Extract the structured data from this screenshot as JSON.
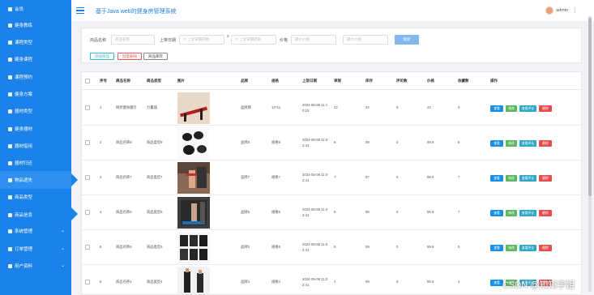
{
  "app": {
    "title": "基于Java web的健身房管理系统",
    "user": "admin",
    "watermark": "CSDN @知知学姐"
  },
  "sidebar": {
    "items": [
      {
        "label": "会员"
      },
      {
        "label": "健身教练"
      },
      {
        "label": "课程类型"
      },
      {
        "label": "健身课程"
      },
      {
        "label": "课程预约"
      },
      {
        "label": "健身方案"
      },
      {
        "label": "器材类型"
      },
      {
        "label": "健身器材"
      },
      {
        "label": "器材借用"
      },
      {
        "label": "器材归还"
      },
      {
        "label": "物品遗失"
      },
      {
        "label": "商品类型"
      },
      {
        "label": "商品信息"
      },
      {
        "label": "系统管理"
      },
      {
        "label": "订单管理"
      },
      {
        "label": "用户资料"
      }
    ]
  },
  "search": {
    "name_label": "商品名称",
    "name_placeholder": "商品名称",
    "date_label": "上架日期",
    "date_start_placeholder": "上架日期开始",
    "date_end_placeholder": "上架日期结束",
    "price_label": "价格",
    "price_min_placeholder": "最小价格",
    "price_max_placeholder": "最大价格",
    "search_button": "搜索",
    "add_button": "添加商品",
    "batch_delete_button": "批量删除",
    "stock_button": "商品库存"
  },
  "table": {
    "headers": [
      "序号",
      "商品名称",
      "商品类型",
      "图片",
      "品牌",
      "规格",
      "上架日期",
      "单限",
      "库存",
      "评论数",
      "价格",
      "收藏数",
      "操作"
    ],
    "rows": [
      {
        "no": "1",
        "name": "网状健身腿针",
        "type": "力量器",
        "brand": "品牌牌",
        "spec": "12*12",
        "date_a": "2024-05-08 11:1",
        "date_b": "0:15",
        "limit": "22",
        "stock": "22",
        "comments": "0",
        "price": "22",
        "fav": "0"
      },
      {
        "no": "2",
        "name": "商品名称8",
        "type": "商品类型8",
        "brand": "品牌8",
        "spec": "规格8",
        "date_a": "2024-05-08 11:0",
        "date_b": "2:41",
        "limit": "8",
        "stock": "99",
        "comments": "0",
        "price": "99.9",
        "fav": "8"
      },
      {
        "no": "3",
        "name": "商品名称7",
        "type": "商品类型7",
        "brand": "品牌7",
        "spec": "规格7",
        "date_a": "2024-05-08 11:0",
        "date_b": "2:41",
        "limit": "7",
        "stock": "97",
        "comments": "0",
        "price": "99.9",
        "fav": "7"
      },
      {
        "no": "4",
        "name": "商品名称6",
        "type": "商品类型6",
        "brand": "品牌6",
        "spec": "规格6",
        "date_a": "2024-05-08 11:0",
        "date_b": "2:41",
        "limit": "6",
        "stock": "98",
        "comments": "0",
        "price": "99.9",
        "fav": "7"
      },
      {
        "no": "5",
        "name": "商品名称5",
        "type": "商品类型5",
        "brand": "品牌5",
        "spec": "规格5",
        "date_a": "2024-05-08 11:0",
        "date_b": "2:41",
        "limit": "5",
        "stock": "99",
        "comments": "0",
        "price": "99.9",
        "fav": "5"
      },
      {
        "no": "6",
        "name": "商品名称4",
        "type": "商品类型4",
        "brand": "品牌4",
        "spec": "规格4",
        "date_a": "2024-05-08 11:0",
        "date_b": "2:41",
        "limit": "4",
        "stock": "99",
        "comments": "0",
        "price": "99.9",
        "fav": "4"
      }
    ],
    "actions": {
      "view": "查看",
      "edit": "修改",
      "comments": "查看评论",
      "delete": "删除"
    }
  },
  "colors": {
    "sidebar": "#1a82e8",
    "primary": "#1890e8",
    "success": "#5cb85c",
    "info": "#2ea8c8",
    "danger": "#e84c4c"
  }
}
